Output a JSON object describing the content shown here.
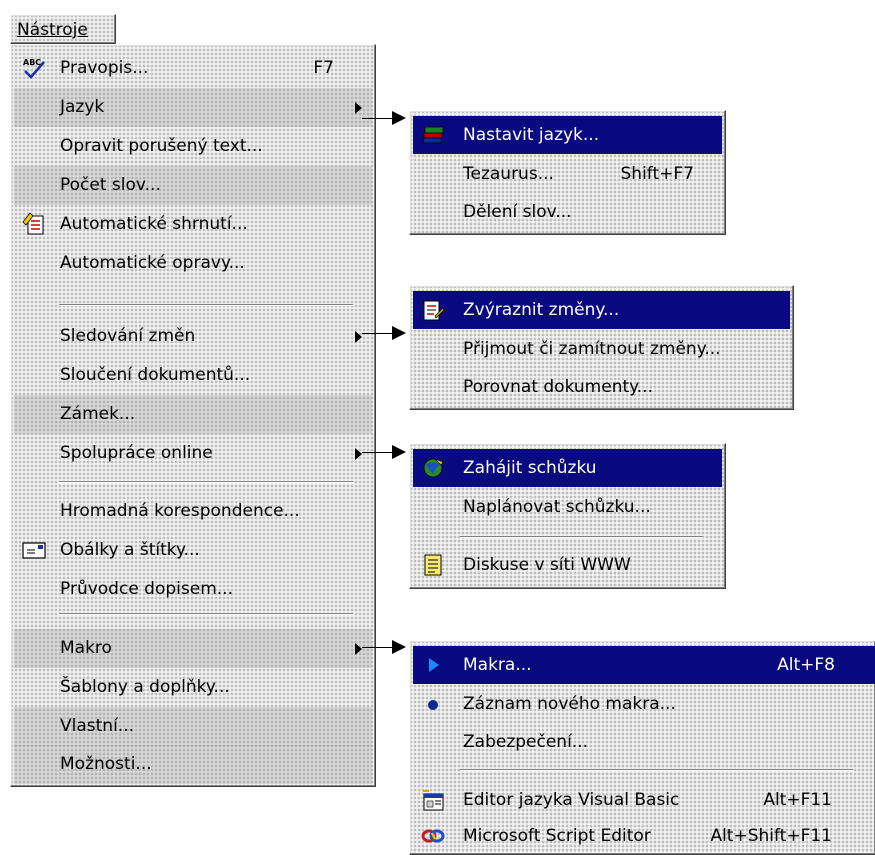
{
  "menubar": {
    "title": "Nástroje"
  },
  "main_menu": {
    "items": [
      {
        "label": "Pravopis...",
        "shortcut": "F7",
        "icon": "spellcheck-icon"
      },
      {
        "label": "Jazyk",
        "submenu": true
      },
      {
        "label": "Opravit porušený text..."
      },
      {
        "label": "Počet slov..."
      },
      {
        "label": "Automatické shrnutí...",
        "icon": "autosummarize-icon"
      },
      {
        "label": "Automatické opravy..."
      },
      {
        "label": "Sledování změn",
        "submenu": true
      },
      {
        "label": "Sloučení dokumentů..."
      },
      {
        "label": "Zámek..."
      },
      {
        "label": "Spolupráce online",
        "submenu": true
      },
      {
        "label": "Hromadná korespondence..."
      },
      {
        "label": "Obálky a štítky...",
        "icon": "envelope-icon"
      },
      {
        "label": "Průvodce dopisem..."
      },
      {
        "label": "Makro",
        "submenu": true
      },
      {
        "label": "Šablony a doplňky..."
      },
      {
        "label": "Vlastní..."
      },
      {
        "label": "Možnosti..."
      }
    ]
  },
  "submenu_jazyk": {
    "items": [
      {
        "label": "Nastavit jazyk...",
        "icon": "language-icon",
        "selected": true
      },
      {
        "label": "Tezaurus...",
        "shortcut": "Shift+F7"
      },
      {
        "label": "Dělení slov..."
      }
    ]
  },
  "submenu_sledovani": {
    "items": [
      {
        "label": "Zvýraznit změny...",
        "icon": "track-changes-icon",
        "selected": true
      },
      {
        "label": "Přijmout či zamítnout změny..."
      },
      {
        "label": "Porovnat dokumenty..."
      }
    ]
  },
  "submenu_online": {
    "items": [
      {
        "label": "Zahájit schůzku",
        "icon": "meeting-icon",
        "selected": true
      },
      {
        "label": "Naplánovat schůzku..."
      },
      {
        "label": "Diskuse v síti WWW",
        "icon": "discussion-icon"
      }
    ]
  },
  "submenu_makro": {
    "items": [
      {
        "label": "Makra...",
        "shortcut": "Alt+F8",
        "icon": "play-icon",
        "selected": true
      },
      {
        "label": "Záznam nového makra...",
        "icon": "record-icon"
      },
      {
        "label": "Zabezpečení..."
      },
      {
        "label": "Editor jazyka Visual Basic",
        "shortcut": "Alt+F11",
        "icon": "vb-editor-icon"
      },
      {
        "label": "Microsoft Script Editor",
        "shortcut": "Alt+Shift+F11",
        "icon": "script-editor-icon"
      }
    ]
  },
  "colors": {
    "selection": "#0a0a80",
    "menu_bg": "#e4e4e4"
  }
}
